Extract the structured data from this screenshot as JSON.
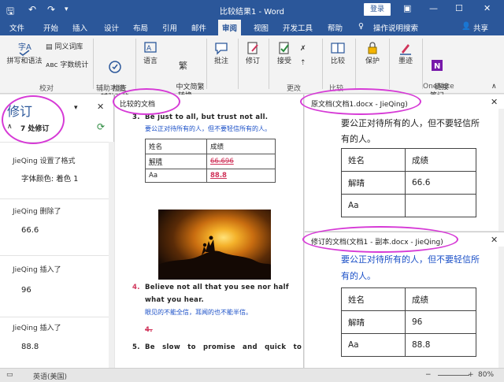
{
  "titlebar": {
    "save_icon": "save-icon",
    "undo_icon": "undo-icon",
    "redo_icon": "redo-icon",
    "title": "比较结果1  -  Word",
    "login": "登录"
  },
  "tabs": [
    "文件",
    "开始",
    "插入",
    "设计",
    "布局",
    "引用",
    "邮件",
    "审阅",
    "视图",
    "开发工具",
    "帮助"
  ],
  "search_hint": "操作说明搜索",
  "share": "共享",
  "ribbon": {
    "spelling": "拼写和语法",
    "thesaurus": "同义词库",
    "wordcount": "字数统计",
    "group_proofing": "校对",
    "accessibility": "检查\n辅助功能",
    "group_access": "辅助功能",
    "language": "语言",
    "chinese_convert": "中文简繁\n转换",
    "comments": "批注",
    "track": "修订",
    "accept": "接受",
    "group_changes": "更改",
    "compare": "比较",
    "group_compare": "比较",
    "protect": "保护",
    "ink": "墨迹",
    "onenote": "链接\n笔记",
    "group_onenote": "OneNote"
  },
  "revisions": {
    "title": "修订",
    "count": "7 处修订",
    "items": [
      {
        "who": "JieQing 设置了格式",
        "detail": "字体颜色: 着色  1"
      },
      {
        "who": "JieQing 删除了",
        "detail": "66.6"
      },
      {
        "who": "JieQing 插入了",
        "detail": "96"
      },
      {
        "who": "JieQing 插入了",
        "detail": "88.8"
      }
    ]
  },
  "compared": {
    "header": "比较的文档",
    "line3_num": "3.",
    "line3_en": "Be just to all, but trust not all.",
    "line3_cn": "要公正对待所有的人，但不要轻信所有的人。",
    "table": [
      [
        "姓名",
        "成绩"
      ],
      [
        "解晴",
        "66.696"
      ],
      [
        "Aa",
        "88.8"
      ]
    ],
    "line4_num": "4.",
    "line4_en_a": "Believe not all that you see nor half",
    "line4_en_b": "what you hear.",
    "line4_cn": "眼见的不能全信，耳闻的也不能半信。",
    "line4b_num": "4.",
    "line5_num": "5.",
    "line5_en": "Be slow to promise and quick to"
  },
  "original": {
    "header": "原文档(文档1.docx - JieQing)",
    "text_a": "要公正对待所有的人，但不要轻信所",
    "text_b": "有的人。",
    "table": [
      [
        "姓名",
        "成绩"
      ],
      [
        "解晴",
        "66.6"
      ],
      [
        "Aa",
        ""
      ]
    ]
  },
  "revised": {
    "header": "修订的文档(文档1 - 副本.docx - JieQing)",
    "text_a": "要公正对待所有的人，但不要轻信所",
    "text_b": "有的人。",
    "table": [
      [
        "姓名",
        "成绩"
      ],
      [
        "解晴",
        "96"
      ],
      [
        "Aa",
        "88.8"
      ]
    ]
  },
  "status": {
    "language": "英语(美国)",
    "zoom": "80%"
  },
  "colors": {
    "accent": "#2b579a",
    "highlight": "#d63ad6",
    "insert": "#1a4fc7",
    "delete": "#d0345a"
  }
}
